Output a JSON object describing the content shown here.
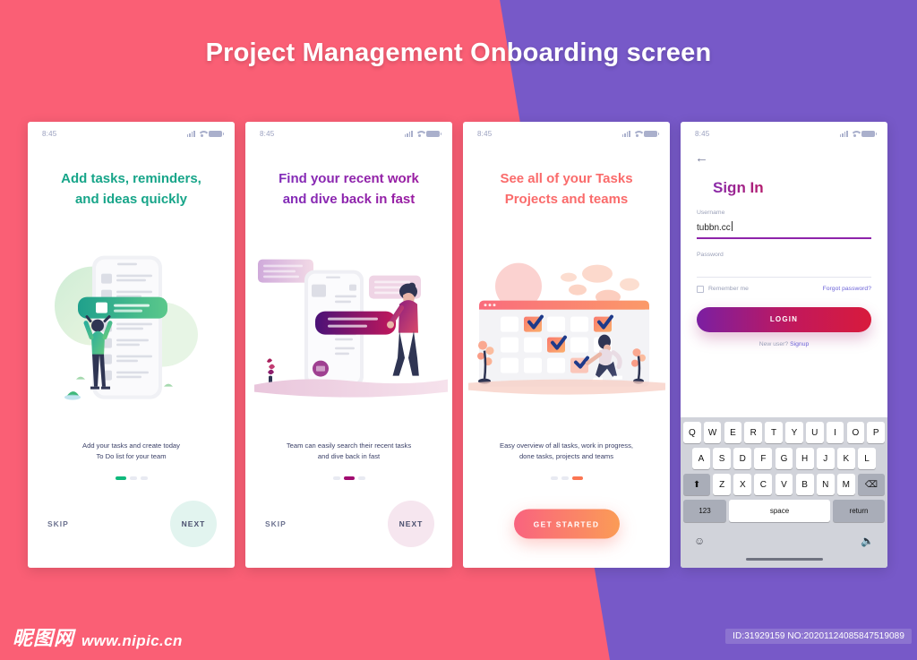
{
  "page": {
    "title": "Project Management Onboarding screen",
    "bg_pink": "#FA5F75",
    "bg_purple": "#7759C8"
  },
  "status_bar": {
    "time": "8:45"
  },
  "screens": [
    {
      "headline": "Add tasks, reminders,\nand ideas quickly",
      "headline_line1": "Add tasks, reminders,",
      "headline_line2": "and ideas quickly",
      "accent": "#17A589",
      "caption_line1": "Add your tasks and create today",
      "caption_line2": "To Do list for your team",
      "active_dot": 0,
      "skip_label": "SKIP",
      "next_label": "NEXT"
    },
    {
      "headline_line1": "Find your recent work",
      "headline_line2": "and dive back in fast",
      "accent": "#A0189B",
      "caption_line1": "Team can easily search their recent tasks",
      "caption_line2": "and dive back in fast",
      "active_dot": 1,
      "skip_label": "SKIP",
      "next_label": "NEXT"
    },
    {
      "headline_line1": "See all of your Tasks",
      "headline_line2": "Projects and teams",
      "accent": "#FA6B6B",
      "caption_line1": "Easy overview of all tasks, work in progress,",
      "caption_line2": "done tasks, projects and teams",
      "active_dot": 2,
      "cta_label": "GET STARTED"
    }
  ],
  "signin": {
    "back_icon": "back-arrow-icon",
    "title": "Sign In",
    "username_label": "Username",
    "username_value": "tubbn.cc",
    "password_label": "Password",
    "password_value": "",
    "remember_label": "Remember me",
    "forgot_label": "Forgot password?",
    "login_label": "LOGIN",
    "newuser_prefix": "New user? ",
    "signup_label": "Signup"
  },
  "keyboard": {
    "row1": [
      "Q",
      "W",
      "E",
      "R",
      "T",
      "Y",
      "U",
      "I",
      "O",
      "P"
    ],
    "row2": [
      "A",
      "S",
      "D",
      "F",
      "G",
      "H",
      "J",
      "K",
      "L"
    ],
    "row3": [
      "Z",
      "X",
      "C",
      "V",
      "B",
      "N",
      "M"
    ],
    "shift_label": "⬆",
    "backspace_label": "⌫",
    "num_label": "123",
    "space_label": "space",
    "return_label": "return",
    "emoji_label": "☺",
    "mic_label": "🎤"
  },
  "footer": {
    "watermark_cn": "昵图网",
    "watermark_url": "www.nipic.cn",
    "id_text": "ID:31929159 NO:20201124085847519089"
  }
}
